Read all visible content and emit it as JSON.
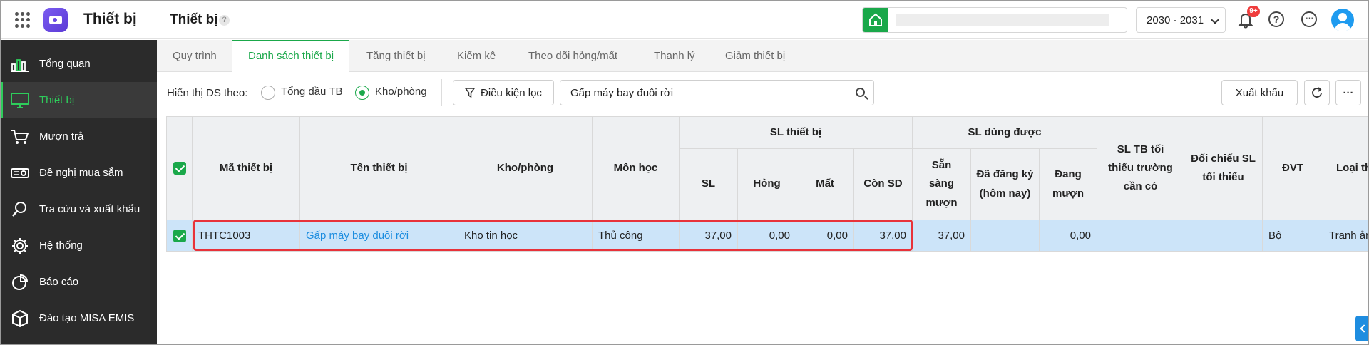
{
  "header": {
    "app_title": "Thiết bị",
    "page_title": "Thiết bị",
    "help_mark": "?",
    "school_year": "2030 - 2031",
    "notification_count": "9+",
    "more_symbol": "···"
  },
  "sidebar": {
    "items": [
      {
        "label": "Tổng quan",
        "icon": "chart-bars-icon"
      },
      {
        "label": "Thiết bị",
        "icon": "monitor-icon",
        "active": true
      },
      {
        "label": "Mượn trả",
        "icon": "cart-icon"
      },
      {
        "label": "Đề nghị mua sắm",
        "icon": "projector-icon"
      },
      {
        "label": "Tra cứu và xuất khẩu",
        "icon": "search-icon"
      },
      {
        "label": "Hệ thống",
        "icon": "gear-icon"
      },
      {
        "label": "Báo cáo",
        "icon": "pie-chart-icon"
      },
      {
        "label": "Đào tạo MISA EMIS",
        "icon": "box-icon"
      }
    ],
    "active_color": "#2ecc5b"
  },
  "tabs": [
    {
      "label": "Quy trình"
    },
    {
      "label": "Danh sách thiết bị",
      "active": true
    },
    {
      "label": "Tăng thiết bị"
    },
    {
      "label": "Kiểm kê"
    },
    {
      "label": "Theo dõi hỏng/mất"
    },
    {
      "label": "Thanh lý"
    },
    {
      "label": "Giảm thiết bị"
    }
  ],
  "filter": {
    "label": "Hiển thị DS theo:",
    "options": [
      {
        "label": "Tổng đầu TB",
        "checked": false
      },
      {
        "label": "Kho/phòng",
        "checked": true
      }
    ],
    "condition_button": "Điều kiện lọc",
    "search_value": "Gấp máy bay đuôi rời",
    "export_button": "Xuất khẩu"
  },
  "table": {
    "headers": {
      "code": "Mã thiết bị",
      "name": "Tên thiết bị",
      "room": "Kho/phòng",
      "subject": "Môn học",
      "group_qty": "SL thiết bị",
      "qty": "SL",
      "broken": "Hỏng",
      "lost": "Mất",
      "remaining": "Còn SD",
      "group_usable": "SL dùng được",
      "ready": "Sẵn sàng mượn",
      "registered": "Đã đăng ký (hôm nay)",
      "borrowing": "Đang mượn",
      "min_required": "SL TB tối thiểu trường cần có",
      "compare_min": "Đối chiếu SL tối thiểu",
      "unit": "ĐVT",
      "type": "Loại thiết bị"
    },
    "rows": [
      {
        "code": "THTC1003",
        "name": "Gấp máy bay đuôi rời",
        "room": "Kho tin học",
        "subject": "Thủ công",
        "qty": "37,00",
        "broken": "0,00",
        "lost": "0,00",
        "remaining": "37,00",
        "ready": "37,00",
        "registered": "",
        "borrowing": "0,00",
        "min_required": "",
        "compare_min": "",
        "unit": "Bộ",
        "type": "Tranh ảnh"
      }
    ]
  },
  "colors": {
    "accent": "#1aa84a",
    "link": "#1a8cdf",
    "selected_row": "#cce4f9",
    "highlight_border": "#e8323a"
  }
}
